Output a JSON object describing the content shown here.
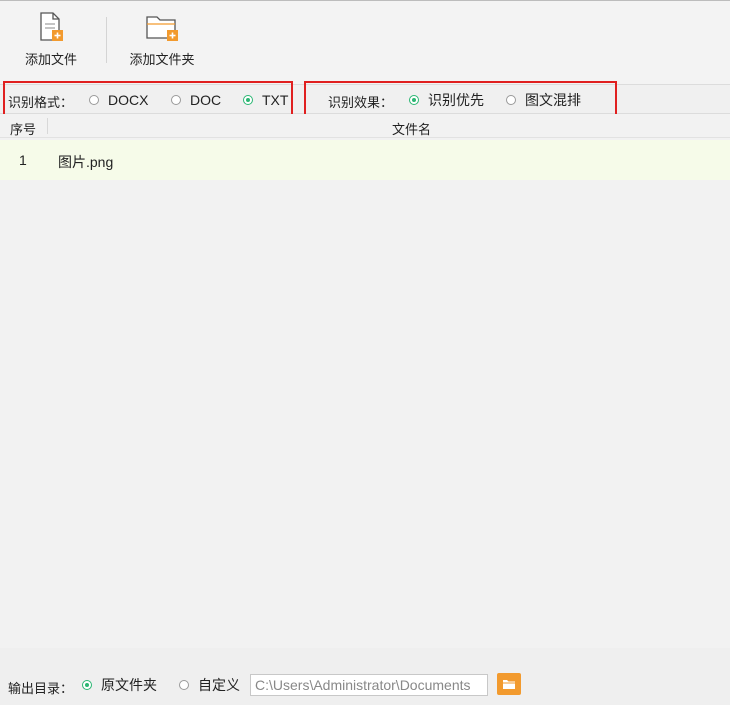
{
  "toolbar": {
    "add_file_label": "添加文件",
    "add_folder_label": "添加文件夹"
  },
  "options": {
    "format_label": "识别格式：",
    "formats": [
      {
        "label": "DOCX",
        "checked": false
      },
      {
        "label": "DOC",
        "checked": false
      },
      {
        "label": "TXT",
        "checked": true
      }
    ],
    "effect_label": "识别效果：",
    "effects": [
      {
        "label": "识别优先",
        "checked": true
      },
      {
        "label": "图文混排",
        "checked": false
      }
    ]
  },
  "table": {
    "col_index": "序号",
    "col_filename": "文件名",
    "rows": [
      {
        "index": "1",
        "filename": "图片.png"
      }
    ]
  },
  "output": {
    "label": "输出目录：",
    "option_original": "原文件夹",
    "option_custom": "自定义",
    "path_value": "C:\\Users\\Administrator\\Documents"
  },
  "colors": {
    "accent_green": "#2bb673",
    "accent_orange": "#f29a2e",
    "highlight_red": "#e02020",
    "row_highlight": "#f6fbe9"
  }
}
